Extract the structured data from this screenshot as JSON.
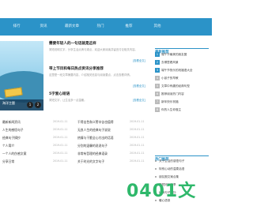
{
  "nav": {
    "items": [
      "排行",
      "资讯",
      "最新文章",
      "热门",
      "推荐",
      "其他"
    ]
  },
  "slider": {
    "caption": "海洋主题",
    "caption2": "面向大众的资讯",
    "dots": [
      "1",
      "2"
    ]
  },
  "articles": [
    {
      "title": "需要年轻人的一句话就是这样",
      "desc": "简短说明文字，分享生活点滴与观点，欢迎大家阅读并留言讨论相关内容。",
      "more": "[查看全文]"
    },
    {
      "title": "带上节目和每日热点资讯分享推荐",
      "desc": "这里是一段文章摘要内容，介绍相关信息与阅读要点，点击查看详情。",
      "more": "[查看全文]"
    },
    {
      "title": "5字爱心短语",
      "desc": "简短文字，让生活多一点温暖。",
      "more": "[查看全文]"
    }
  ],
  "sidebar": {
    "latest_title": "最新推荐",
    "latest": [
      "端午节最美的朋友圈",
      "去哪里看风景",
      "端午节快乐的祝福语大全",
      "小孩子的早教",
      "文章中有趣的经典句型",
      "推荐阅读热门内容",
      "新年快乐祝福",
      "你的人生你做主"
    ],
    "hot_title": "热门推荐",
    "hot": [
      "关于生活的感悟句子",
      "特别心动的温柔话语",
      "朋友圈文案合集",
      "简短好句分享",
      "经典句子摘抄",
      "暖心语录"
    ]
  },
  "lower": {
    "left": [
      {
        "title": "最新新闻资讯",
        "date": "2019-01-11"
      },
      {
        "title": "人生的感悟句子",
        "date": "2019-01-11"
      },
      {
        "title": "经典句子摘抄",
        "date": "2019-01-11"
      },
      {
        "title": "个人简介",
        "date": "2019-01-11"
      },
      {
        "title": "一个人的伤感文案",
        "date": "2019-01-11"
      },
      {
        "title": "分享日常",
        "date": "2019-01-11"
      }
    ],
    "right": [
      {
        "title": "干得出色和义警辛苦也值得",
        "date": "2019-01-11"
      },
      {
        "title": "无良人生的经典句子说说",
        "date": "2019-01-11"
      },
      {
        "title": "热情与干脆全心付出的话语",
        "date": "2019-01-11"
      },
      {
        "title": "分别的温馨的说说句子",
        "date": "2019-01-11"
      },
      {
        "title": "非常有哲理的经典语录",
        "date": "2019-01-11"
      },
      {
        "title": "关于时光的文字句子",
        "date": "2019-01-11"
      }
    ]
  },
  "watermark": "0401文章网",
  "colors": {
    "nav": "#2b93c8",
    "accent": "#2fb86b"
  }
}
